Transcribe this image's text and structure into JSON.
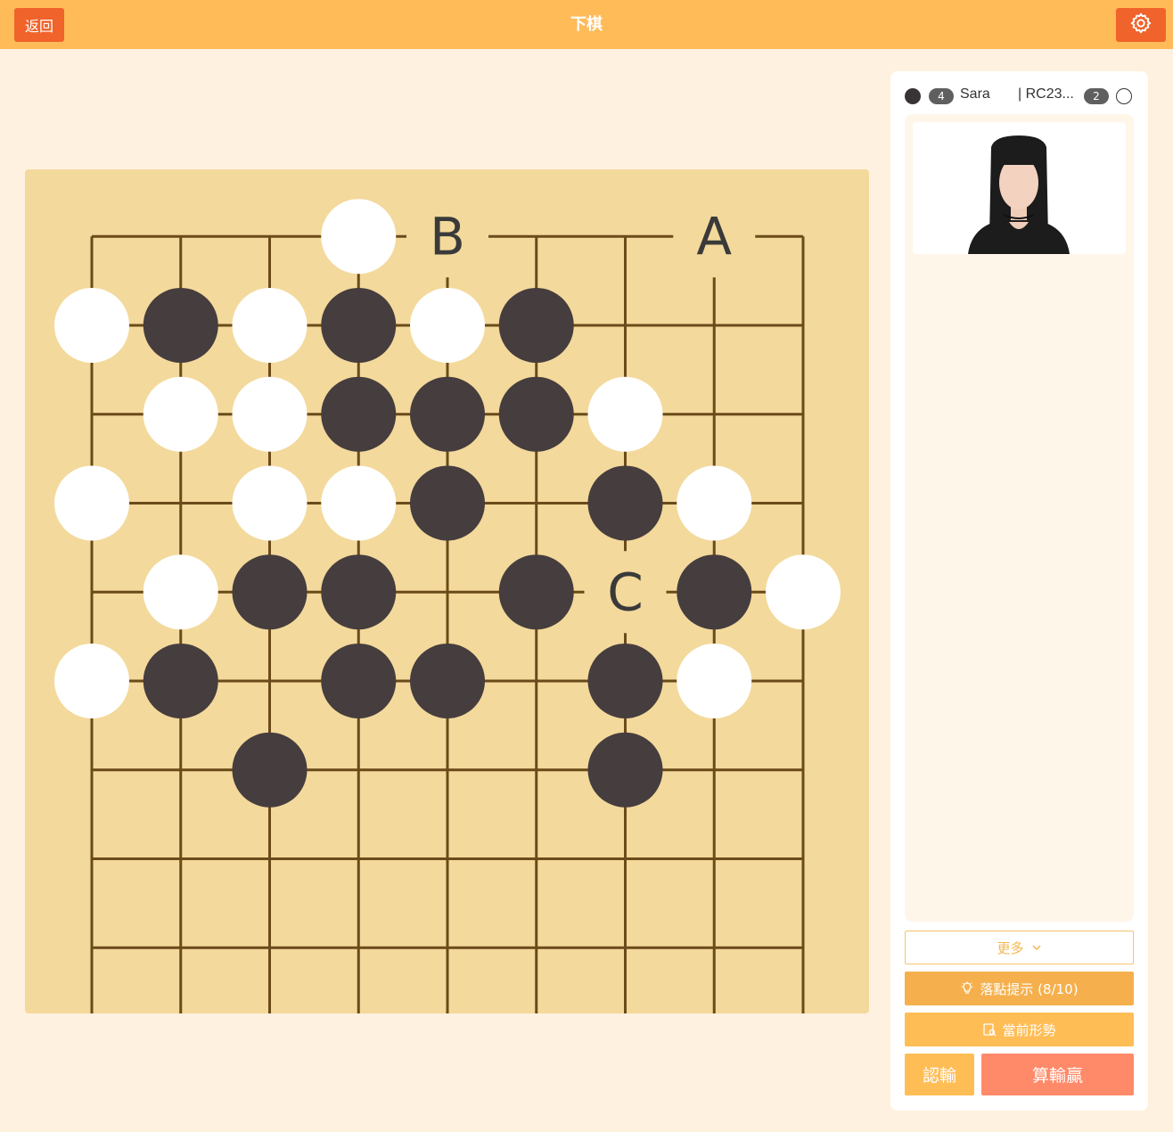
{
  "header": {
    "back_label": "返回",
    "title": "下棋",
    "settings_icon": "gear-icon"
  },
  "board": {
    "size": 9,
    "line_color": "#6b4a1a",
    "board_color": "#f3d99b",
    "star_point": [
      4,
      4
    ],
    "black_stones": [
      [
        1,
        0
      ],
      [
        3,
        0
      ],
      [
        5,
        0
      ],
      [
        3,
        1
      ],
      [
        4,
        1
      ],
      [
        5,
        1
      ],
      [
        4,
        2
      ],
      [
        6,
        2
      ],
      [
        2,
        3
      ],
      [
        3,
        3
      ],
      [
        5,
        3
      ],
      [
        7,
        3
      ],
      [
        1,
        4
      ],
      [
        3,
        4
      ],
      [
        4,
        4
      ],
      [
        6,
        4
      ],
      [
        2,
        5
      ],
      [
        6,
        5
      ]
    ],
    "white_stones": [
      [
        3,
        -1
      ],
      [
        0,
        0
      ],
      [
        2,
        0
      ],
      [
        4,
        0
      ],
      [
        1,
        1
      ],
      [
        2,
        1
      ],
      [
        6,
        1
      ],
      [
        0,
        2
      ],
      [
        2,
        2
      ],
      [
        3,
        2
      ],
      [
        7,
        2
      ],
      [
        1,
        3
      ],
      [
        8,
        3
      ],
      [
        0,
        4
      ],
      [
        7,
        4
      ]
    ],
    "labels": [
      {
        "text": "B",
        "col": 4,
        "row": -1
      },
      {
        "text": "A",
        "col": 7,
        "row": -1
      },
      {
        "text": "C",
        "col": 6,
        "row": 3
      }
    ]
  },
  "players": {
    "black": {
      "name": "Sara",
      "count": "4"
    },
    "white": {
      "name": "| RC23...",
      "count": "2"
    }
  },
  "buttons": {
    "more": "更多",
    "hint": "落點提示 (8/10)",
    "situation": "當前形勢",
    "resign": "認輸",
    "score": "算輸贏"
  }
}
